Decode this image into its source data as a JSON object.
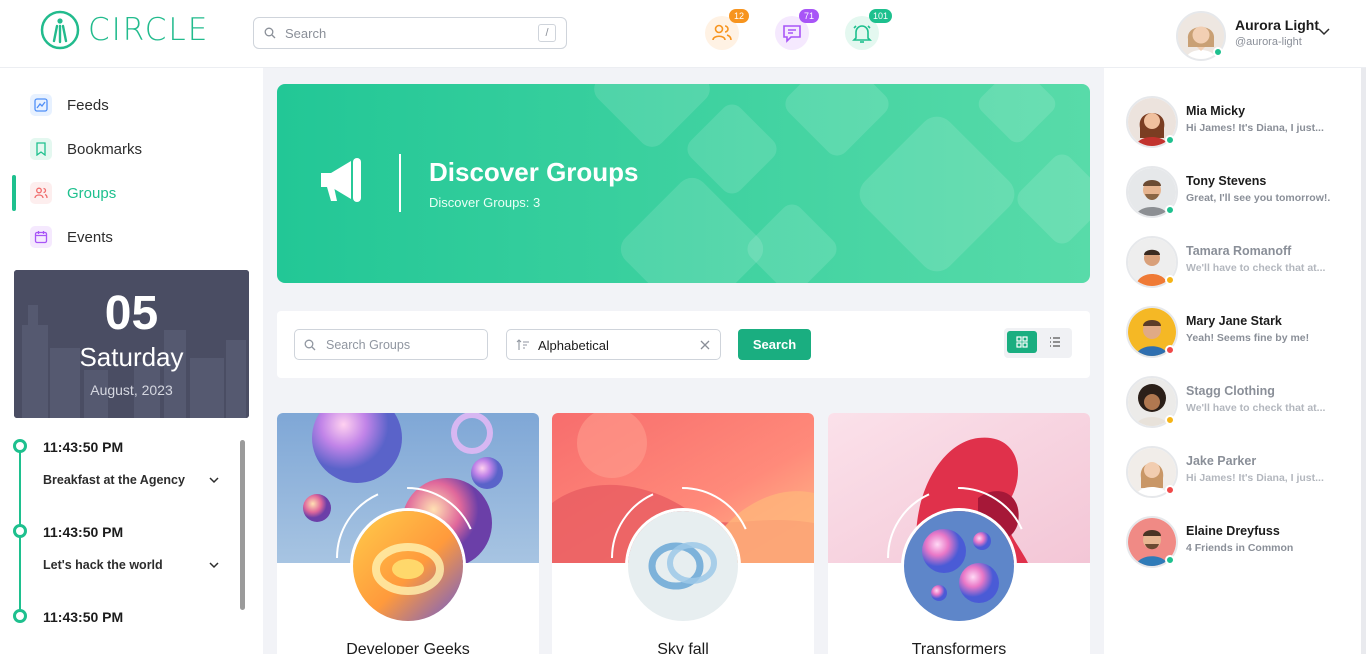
{
  "brand": {
    "name": "CIRCLE",
    "accent": "#22bb8d"
  },
  "header": {
    "search": {
      "placeholder": "Search",
      "shortcut": "/"
    },
    "icons": [
      {
        "name": "friends-icon",
        "badge": "12",
        "color": "#f7941e"
      },
      {
        "name": "messages-icon",
        "badge": "71",
        "color": "#a855f7"
      },
      {
        "name": "notifications-icon",
        "badge": "101",
        "color": "#1ec08e"
      }
    ],
    "user": {
      "name": "Aurora Light",
      "handle": "@aurora-light"
    }
  },
  "sidebar": {
    "items": [
      {
        "label": "Feeds",
        "icon": "feeds-icon"
      },
      {
        "label": "Bookmarks",
        "icon": "bookmark-icon"
      },
      {
        "label": "Groups",
        "icon": "groups-icon",
        "active": true
      },
      {
        "label": "Events",
        "icon": "calendar-icon"
      }
    ],
    "date": {
      "day": "05",
      "weekday": "Saturday",
      "month_year": "August, 2023"
    },
    "timeline": [
      {
        "time": "11:43:50 PM",
        "event": "Breakfast at the Agency"
      },
      {
        "time": "11:43:50 PM",
        "event": "Let's hack the world"
      },
      {
        "time": "11:43:50 PM",
        "event": ""
      }
    ]
  },
  "banner": {
    "title": "Discover Groups",
    "subtitle": "Discover Groups: 3",
    "icon": "megaphone-icon"
  },
  "filters": {
    "search_placeholder": "Search Groups",
    "sort_value": "Alphabetical",
    "search_button": "Search",
    "view": "grid"
  },
  "groups": [
    {
      "name": "Developer Geeks"
    },
    {
      "name": "Sky fall"
    },
    {
      "name": "Transformers"
    }
  ],
  "contacts": [
    {
      "name": "Mia Micky",
      "message": "Hi James! It's Diana, I just...",
      "status": "online",
      "muted": false
    },
    {
      "name": "Tony Stevens",
      "message": "Great, I'll see you tomorrow!.",
      "status": "online",
      "muted": false
    },
    {
      "name": "Tamara Romanoff",
      "message": "We'll have to check that at...",
      "status": "away",
      "muted": true
    },
    {
      "name": "Mary Jane Stark",
      "message": "Yeah! Seems fine by me!",
      "status": "busy",
      "muted": false
    },
    {
      "name": "Stagg Clothing",
      "message": "We'll have to check that at...",
      "status": "away",
      "muted": true
    },
    {
      "name": "Jake Parker",
      "message": "Hi James! It's Diana, I just...",
      "status": "busy",
      "muted": true
    },
    {
      "name": "Elaine Dreyfuss",
      "message": "4 Friends in Common",
      "status": "online",
      "muted": false
    }
  ],
  "status_colors": {
    "online": "#1ec08e",
    "away": "#f5b416",
    "busy": "#f04848"
  }
}
